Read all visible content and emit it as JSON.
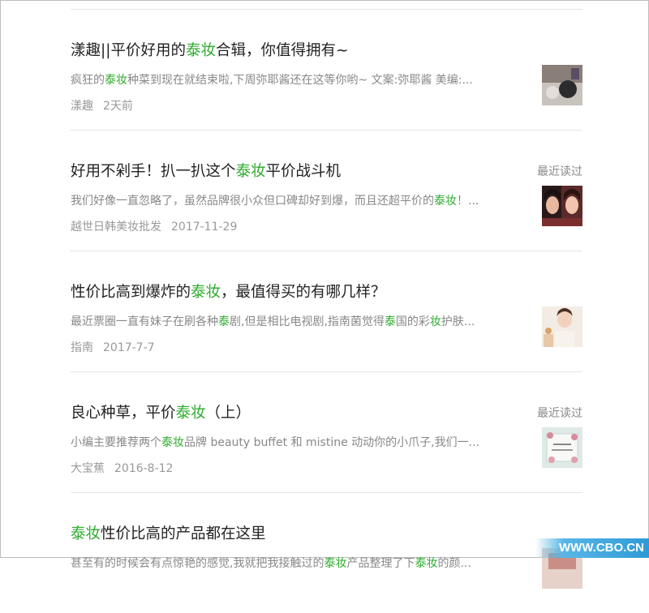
{
  "keyword": "泰妆",
  "recent_label": "最近读过",
  "articles": [
    {
      "title": [
        "漾趣||平价好用的",
        "泰妆",
        "合辑，你值得拥有~"
      ],
      "summary": [
        "疯狂的",
        "泰妆",
        "种菜到现在就结束啦,下周弥耶酱还在这等你哟~ 文案:弥耶酱 美编:..."
      ],
      "source": "漾趣",
      "date": "2天前",
      "recent": false
    },
    {
      "title": [
        "好用不剁手！扒一扒这个",
        "泰妆",
        "平价战斗机"
      ],
      "summary": [
        "我们好像一直忽略了，虽然品牌很小众但口碑却好到爆，而且还超平价的",
        "泰妆",
        "！..."
      ],
      "source": "越世日韩美妆批发",
      "date": "2017-11-29",
      "recent": true
    },
    {
      "title": [
        "性价比高到爆炸的",
        "泰妆",
        "，最值得买的有哪几样？"
      ],
      "summary": [
        "最近票圈一直有妹子在刷各种",
        "泰",
        "剧,但是相比电视剧,指南菌觉得",
        "泰",
        "国的彩",
        "妆",
        "护肤..."
      ],
      "source": "指南",
      "date": "2017-7-7",
      "recent": false
    },
    {
      "title": [
        "良心种草，平价",
        "泰妆",
        "（上）"
      ],
      "summary": [
        "小编主要推荐两个",
        "泰妆",
        "品牌 beauty buffet 和 mistine 动动你的小爪子,我们一..."
      ],
      "source": "大宝蕉",
      "date": "2016-8-12",
      "recent": true
    },
    {
      "title": [
        "泰妆",
        "性价比高的产品都在这里"
      ],
      "summary": [
        "甚至有的时候会有点惊艳的感觉,我就把我接触过的",
        "泰妆",
        "产品整理了下",
        "泰妆",
        "的颜..."
      ],
      "source": "",
      "date": "",
      "recent": false
    }
  ],
  "watermark": "WWW.CBO.CN"
}
